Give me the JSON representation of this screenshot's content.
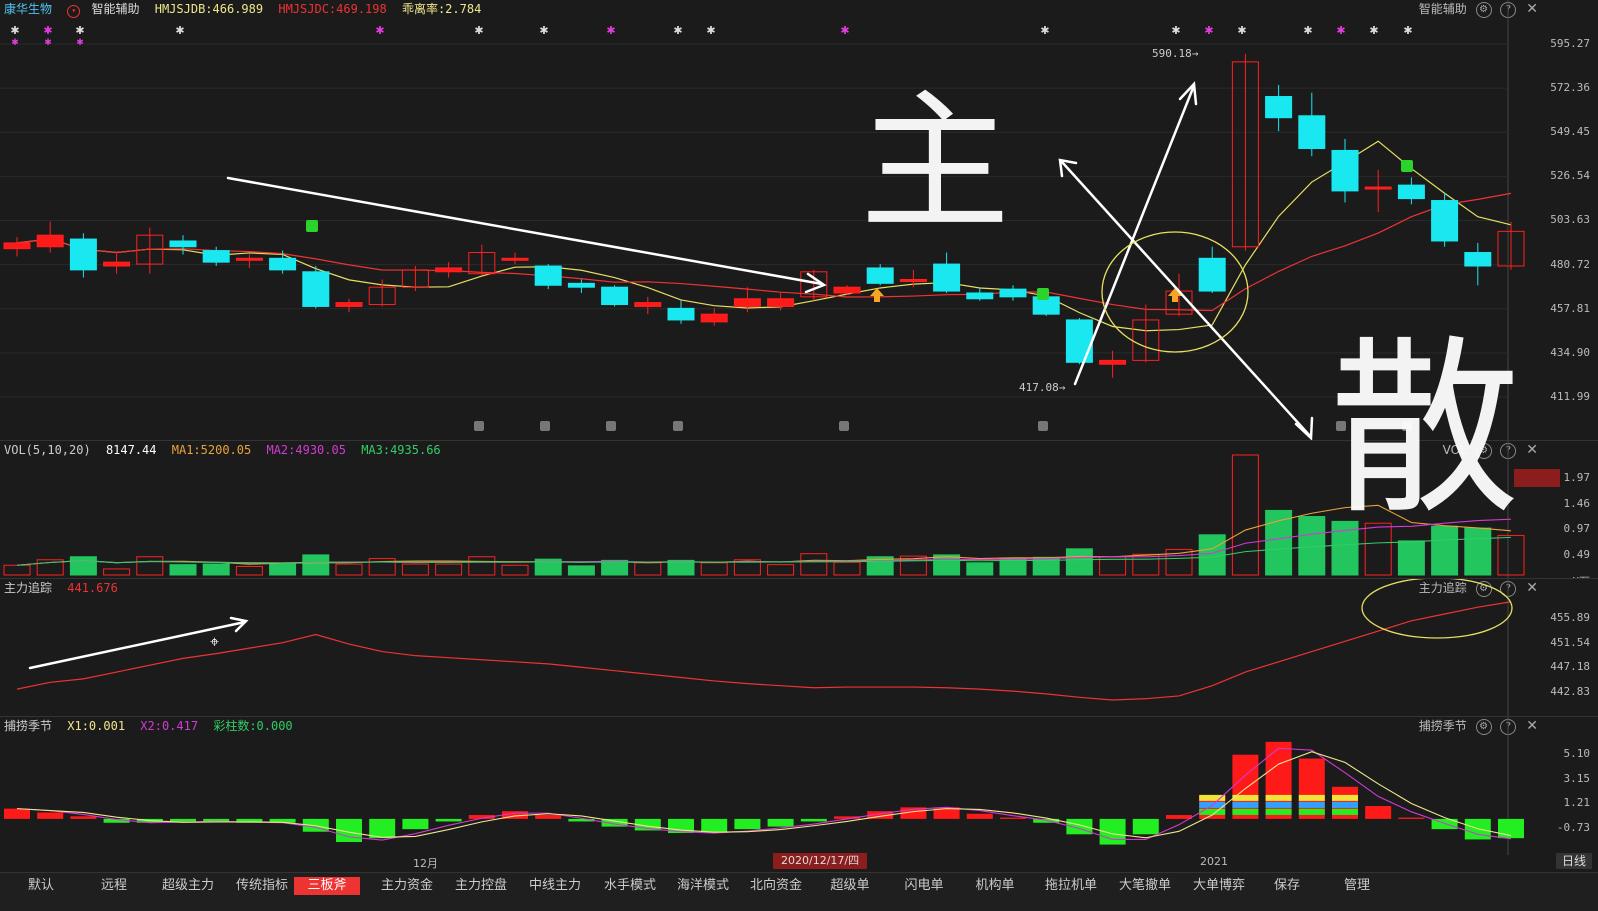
{
  "stock": {
    "name": "康华生物",
    "indicator": "智能辅助",
    "hmjsjdb": "HMJSJDB:466.989",
    "hmjsjdc": "HMJSJDC:469.198",
    "deviation": "乖离率:2.784"
  },
  "main_panel": {
    "right_title": "智能辅助",
    "price_ticks": [
      "595.27",
      "572.36",
      "549.45",
      "526.54",
      "503.63",
      "480.72",
      "457.81",
      "434.90",
      "411.99"
    ],
    "high_label": "590.18",
    "low_label": "417.08"
  },
  "vol_panel": {
    "label": "VOL(5,10,20)",
    "value": "8147.44",
    "ma1": "MA1:5200.05",
    "ma2": "MA2:4930.05",
    "ma3": "MA3:4935.66",
    "right_title": "VOL",
    "ticks": [
      "1.97",
      "1.46",
      "0.97",
      "0.49",
      "X万"
    ],
    "colors": {
      "up": "#ff2020",
      "down": "#22c55e",
      "ma1": "#e8a33c",
      "ma2": "#d23ad2",
      "ma3": "#33cc66"
    }
  },
  "track_panel": {
    "label": "主力追踪",
    "value": "441.676",
    "right_title": "主力追踪",
    "ticks": [
      "455.89",
      "451.54",
      "447.18",
      "442.83"
    ]
  },
  "season_panel": {
    "label": "捕捞季节",
    "x1": "X1:0.001",
    "x2": "X2:0.417",
    "count": "彩柱数:0.000",
    "right_title": "捕捞季节",
    "ticks": [
      "5.10",
      "3.15",
      "1.21",
      "-0.73"
    ]
  },
  "xaxis": {
    "month1": "12月",
    "date_cursor": "2020/12/17/四",
    "year": "2021",
    "period": "日线"
  },
  "tabs": [
    "默认",
    "远程",
    "超级主力",
    "传统指标",
    "三板斧",
    "主力资金",
    "主力控盘",
    "中线主力",
    "水手模式",
    "海洋模式",
    "北向资金",
    "超级单",
    "闪电单",
    "机构单",
    "拖拉机单",
    "大笔撤单",
    "大单博弈",
    "保存",
    "管理"
  ],
  "active_tab": "三板斧",
  "annotations": {
    "char1": "主",
    "char2": "散"
  },
  "chart_data": {
    "type": "candlestick",
    "ylim": [
      411.99,
      595.27
    ],
    "candles": [
      {
        "o": 489,
        "c": 492,
        "h": 495,
        "l": 485
      },
      {
        "o": 490,
        "c": 496,
        "h": 503,
        "l": 487
      },
      {
        "o": 494,
        "c": 478,
        "h": 497,
        "l": 474
      },
      {
        "o": 480,
        "c": 482,
        "h": 487,
        "l": 476
      },
      {
        "o": 481,
        "c": 496,
        "h": 500,
        "l": 476
      },
      {
        "o": 493,
        "c": 490,
        "h": 496,
        "l": 486
      },
      {
        "o": 488,
        "c": 482,
        "h": 490,
        "l": 480
      },
      {
        "o": 483,
        "c": 484,
        "h": 486,
        "l": 479
      },
      {
        "o": 484,
        "c": 478,
        "h": 488,
        "l": 476
      },
      {
        "o": 477,
        "c": 459,
        "h": 480,
        "l": 458
      },
      {
        "o": 459,
        "c": 461,
        "h": 463,
        "l": 456
      },
      {
        "o": 460,
        "c": 469,
        "h": 473,
        "l": 459
      },
      {
        "o": 469,
        "c": 478,
        "h": 480,
        "l": 467
      },
      {
        "o": 477,
        "c": 479,
        "h": 482,
        "l": 474
      },
      {
        "o": 476,
        "c": 487,
        "h": 491,
        "l": 475
      },
      {
        "o": 483,
        "c": 484,
        "h": 487,
        "l": 481
      },
      {
        "o": 480,
        "c": 470,
        "h": 481,
        "l": 468
      },
      {
        "o": 471,
        "c": 469,
        "h": 473,
        "l": 466
      },
      {
        "o": 469,
        "c": 460,
        "h": 470,
        "l": 459
      },
      {
        "o": 459,
        "c": 461,
        "h": 464,
        "l": 455
      },
      {
        "o": 458,
        "c": 452,
        "h": 462,
        "l": 450
      },
      {
        "o": 451,
        "c": 455,
        "h": 458,
        "l": 449
      },
      {
        "o": 459,
        "c": 463,
        "h": 469,
        "l": 456
      },
      {
        "o": 459,
        "c": 463,
        "h": 466,
        "l": 457
      },
      {
        "o": 464,
        "c": 477,
        "h": 478,
        "l": 462
      },
      {
        "o": 466,
        "c": 469,
        "h": 470,
        "l": 465
      },
      {
        "o": 479,
        "c": 471,
        "h": 481,
        "l": 470
      },
      {
        "o": 473,
        "c": 473,
        "h": 478,
        "l": 469
      },
      {
        "o": 481,
        "c": 467,
        "h": 487,
        "l": 466
      },
      {
        "o": 466,
        "c": 463,
        "h": 469,
        "l": 462
      },
      {
        "o": 468,
        "c": 464,
        "h": 470,
        "l": 462
      },
      {
        "o": 464,
        "c": 455,
        "h": 464,
        "l": 454
      },
      {
        "o": 452,
        "c": 430,
        "h": 453,
        "l": 429
      },
      {
        "o": 429,
        "c": 431,
        "h": 436,
        "l": 422
      },
      {
        "o": 431,
        "c": 452,
        "h": 460,
        "l": 430
      },
      {
        "o": 455,
        "c": 467,
        "h": 476,
        "l": 454
      },
      {
        "o": 484,
        "c": 467,
        "h": 490,
        "l": 466
      },
      {
        "o": 490,
        "c": 586,
        "h": 590.18,
        "l": 488
      },
      {
        "o": 568,
        "c": 557,
        "h": 574,
        "l": 550
      },
      {
        "o": 558,
        "c": 541,
        "h": 570,
        "l": 537
      },
      {
        "o": 540,
        "c": 519,
        "h": 546,
        "l": 513
      },
      {
        "o": 521,
        "c": 521,
        "h": 530,
        "l": 508
      },
      {
        "o": 522,
        "c": 515,
        "h": 526,
        "l": 512
      },
      {
        "o": 514,
        "c": 493,
        "h": 518,
        "l": 490
      },
      {
        "o": 487,
        "c": 480,
        "h": 492,
        "l": 470
      },
      {
        "o": 480,
        "c": 498,
        "h": 503,
        "l": 478
      }
    ],
    "volume": [
      0.16,
      0.25,
      0.3,
      0.1,
      0.3,
      0.17,
      0.18,
      0.14,
      0.18,
      0.33,
      0.18,
      0.27,
      0.18,
      0.18,
      0.3,
      0.16,
      0.26,
      0.15,
      0.24,
      0.2,
      0.24,
      0.2,
      0.25,
      0.17,
      0.35,
      0.21,
      0.3,
      0.31,
      0.33,
      0.2,
      0.27,
      0.29,
      0.43,
      0.3,
      0.34,
      0.42,
      0.66,
      1.97,
      1.06,
      0.96,
      0.88,
      0.85,
      0.56,
      0.8,
      0.77,
      0.65
    ],
    "track": [
      444.0,
      445.0,
      445.5,
      446.5,
      447.5,
      448.5,
      449.2,
      450.0,
      450.8,
      452.0,
      450.6,
      449.5,
      448.9,
      448.6,
      448.3,
      448.0,
      447.7,
      447.2,
      446.7,
      446.2,
      445.7,
      445.2,
      444.8,
      444.5,
      444.2,
      444.3,
      444.3,
      444.3,
      444.2,
      444.0,
      443.7,
      443.3,
      442.8,
      442.4,
      442.6,
      443.0,
      444.5,
      446.5,
      448.0,
      449.5,
      451.0,
      452.5,
      454.0,
      455.0,
      456.0,
      456.8
    ],
    "season": [
      0.8,
      0.5,
      0.2,
      -0.3,
      -0.3,
      -0.2,
      -0.2,
      -0.3,
      -0.3,
      -1.0,
      -1.8,
      -1.5,
      -0.8,
      -0.2,
      0.3,
      0.6,
      0.3,
      -0.2,
      -0.6,
      -0.9,
      -1.1,
      -1.1,
      -0.8,
      -0.6,
      -0.2,
      0.2,
      0.6,
      0.9,
      0.9,
      0.4,
      0.1,
      -0.3,
      -1.2,
      -2.0,
      -1.2,
      0.3,
      1.8,
      5.0,
      6.0,
      4.7,
      2.5,
      1.0,
      0.1,
      -0.8,
      -1.6,
      -1.5
    ]
  }
}
